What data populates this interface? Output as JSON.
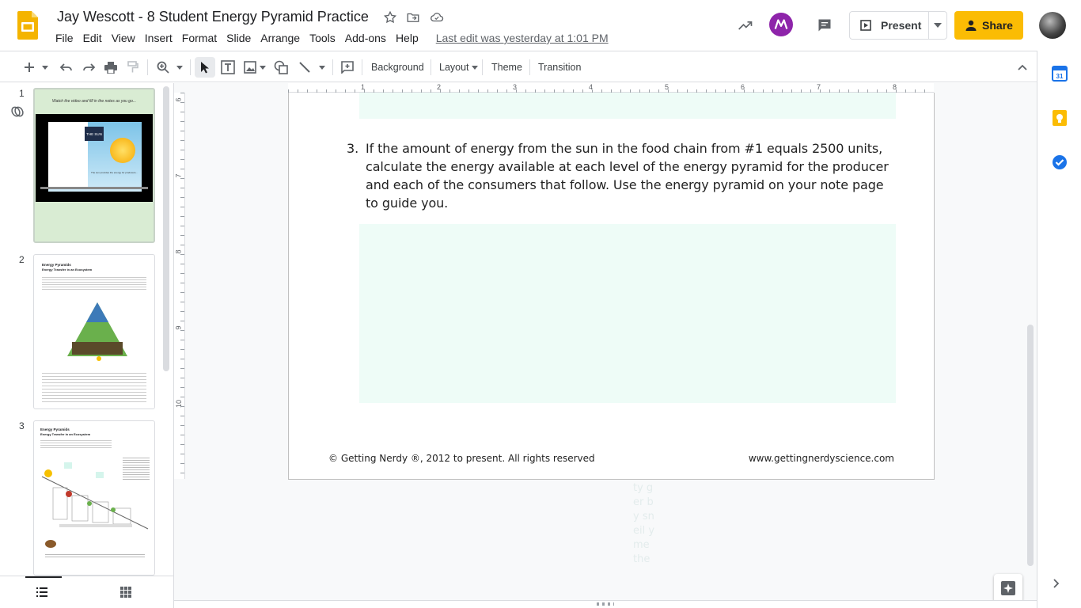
{
  "app": {
    "doc_title": "Jay Wescott - 8 Student Energy Pyramid Practice",
    "last_edit": "Last edit was yesterday at 1:01 PM"
  },
  "menu": [
    "File",
    "Edit",
    "View",
    "Insert",
    "Format",
    "Slide",
    "Arrange",
    "Tools",
    "Add-ons",
    "Help"
  ],
  "header_buttons": {
    "present_label": "Present",
    "share_label": "Share"
  },
  "toolbar": {
    "background_label": "Background",
    "layout_label": "Layout",
    "theme_label": "Theme",
    "transition_label": "Transition"
  },
  "filmstrip": {
    "slides": [
      {
        "number": "1",
        "title": "Watch the video and fill in the notes as you go...",
        "caption": "THE SUN",
        "subcaption": "The sun provides the energy for producers..."
      },
      {
        "number": "2",
        "title": "Energy Pyramids",
        "subtitle": "Energy Transfer in an Ecosystem"
      },
      {
        "number": "3",
        "title": "Energy Pyramids",
        "subtitle": "Energy Transfer in an Ecosystem"
      }
    ]
  },
  "rulers": {
    "horizontal": [
      "1",
      "2",
      "3",
      "4",
      "5",
      "6",
      "7",
      "8"
    ],
    "vertical": [
      "6",
      "7",
      "8",
      "9",
      "10"
    ]
  },
  "slide": {
    "question_number": "3.",
    "question_text": "If the amount of energy from the sun in the food chain from #1 equals 2500 units, calculate the energy available at each level of the energy pyramid for the producer and each of the consumers that follow.  Use the energy pyramid on your note page to guide you.",
    "copyright": "© Getting Nerdy ®, 2012 to present. All rights reserved",
    "website": "www.gettingnerdyscience.com",
    "ghost_text": "ty ger by sn eil y me the"
  },
  "colors": {
    "share_yellow": "#fbbc04",
    "slides_logo": "#f4b400",
    "answer_box": "#eefcf7",
    "filmstrip_slide1_bg": "#d9ecd3"
  },
  "icons": {
    "star": "star-icon",
    "move": "folder-move-icon",
    "cloud": "cloud-saved-icon",
    "activity": "trending-icon",
    "comments": "comment-icon"
  }
}
